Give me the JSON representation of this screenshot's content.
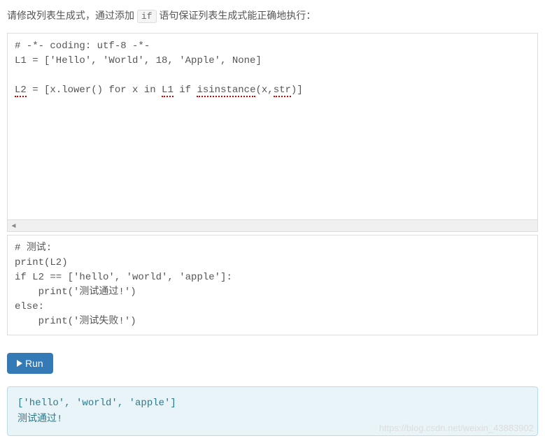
{
  "instruction": {
    "prefix": "请修改列表生成式，通过添加 ",
    "code": "if",
    "suffix": " 语句保证列表生成式能正确地执行："
  },
  "code_editor": {
    "line1": "# -*- coding: utf-8 -*-",
    "line2_a": "L1 = ['Hello', 'World', 18, 'Apple', None]",
    "line3_a": "L2",
    "line3_b": " = [x.lower() for x in ",
    "line3_c": "L1",
    "line3_d": " if ",
    "line3_e": "isinstance",
    "line3_f": "(x,",
    "line3_g": "str",
    "line3_h": ")]"
  },
  "test_code": "# 测试:\nprint(L2)\nif L2 == ['hello', 'world', 'apple']:\n    print('测试通过!')\nelse:\n    print('测试失败!')",
  "run_button_label": "Run",
  "output": "['hello', 'world', 'apple']\n测试通过!",
  "watermark": "https://blog.csdn.net/weixin_43883902"
}
